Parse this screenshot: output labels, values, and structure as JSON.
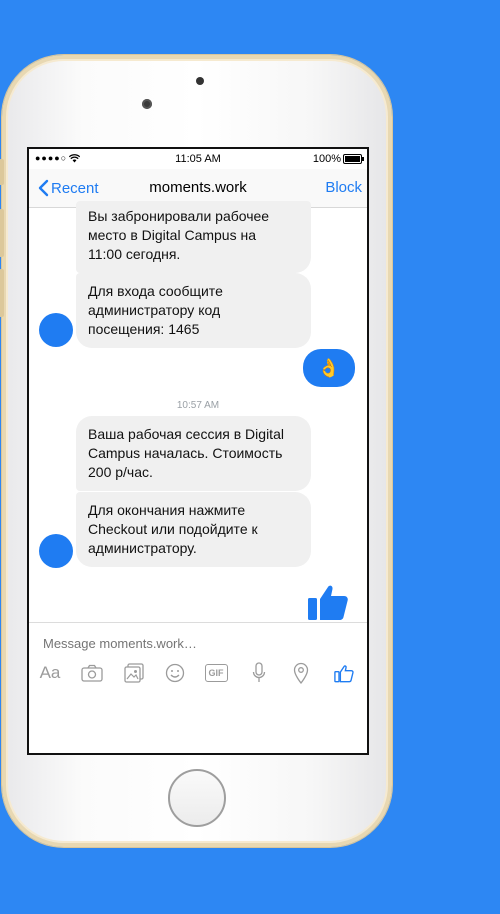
{
  "status": {
    "signal": "●●●●○",
    "time": "11:05 AM",
    "battery": "100%"
  },
  "nav": {
    "back_label": "Recent",
    "title": "moments.work",
    "block_label": "Block"
  },
  "messages": {
    "m1": "Вы забронировали рабочее\nместо в Digital Campus на\n11:00 сегодня.",
    "m2": "Для входа сообщите\nадминистратору код\nпосещения: 1465",
    "m3_emoji": "👌",
    "timestamp": "10:57 AM",
    "m4": "Ваша рабочая сессия в Digital\nCampus началась. Стоимость\n200 р/час.",
    "m5": "Для окончания нажмите\nCheckout или подойдите к\nадминистратору."
  },
  "composer": {
    "placeholder": "Message moments.work…",
    "aa_label": "Aa",
    "gif_label": "GIF"
  },
  "colors": {
    "accent": "#1f7cf2",
    "background": "#2d87f3",
    "bubble": "#f0f0f0"
  }
}
